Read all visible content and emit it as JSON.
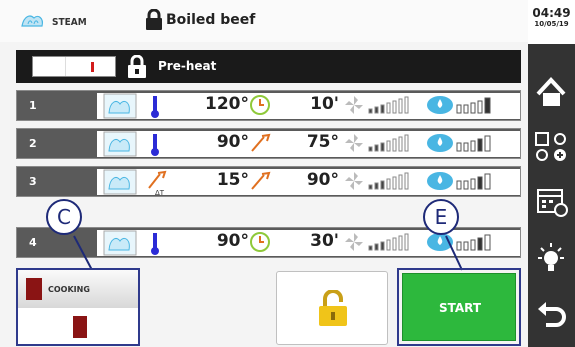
{
  "header": {
    "steam_label": "STEAM",
    "title": "Boiled beef"
  },
  "preheat": {
    "label": "Pre-heat"
  },
  "phases": [
    {
      "num": "1",
      "value1": "120°",
      "value2": "10'",
      "mode1": "thermometer",
      "mode2": "timer"
    },
    {
      "num": "2",
      "value1": "90°",
      "value2": "75°",
      "mode1": "thermometer",
      "mode2": "core-probe"
    },
    {
      "num": "3",
      "value1": "15°",
      "value2": "90°",
      "mode1": "delta-t-probe",
      "mode2": "core-probe"
    },
    {
      "num": "4",
      "value1": "90°",
      "value2": "30'",
      "mode1": "thermometer",
      "mode2": "timer"
    }
  ],
  "cooking": {
    "label": "COOKING"
  },
  "start": {
    "label": "START"
  },
  "callouts": {
    "c": "C",
    "e": "E"
  },
  "clock": {
    "time": "04:49",
    "date": "10/05/19"
  },
  "sidebar": [
    "home-icon",
    "program-settings-icon",
    "calendar-icon",
    "light-icon",
    "back-icon"
  ],
  "colors": {
    "start": "#2db83d",
    "accent": "#2f3a8c",
    "red": "#d21c1c",
    "steam": "#49b6e3"
  }
}
